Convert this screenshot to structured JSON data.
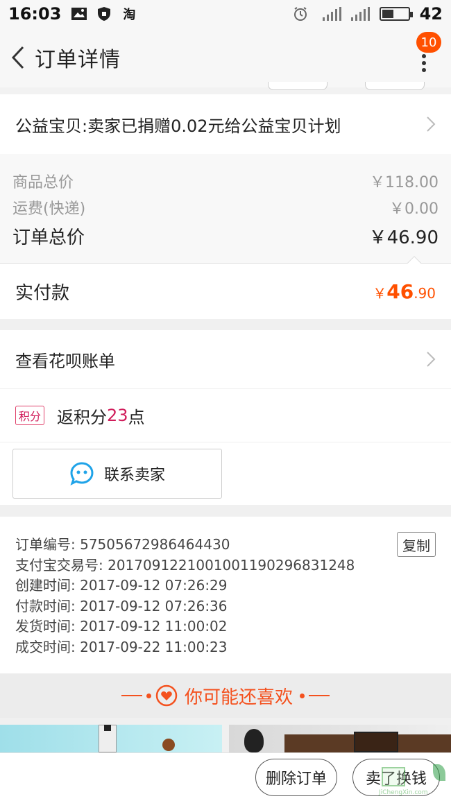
{
  "status_bar": {
    "time": "16:03",
    "taobao_glyph": "淘",
    "battery_level": "42",
    "icons": [
      "image-icon",
      "shield-icon",
      "taobao-icon",
      "alarm-icon",
      "signal-icon",
      "signal-icon",
      "battery-icon"
    ]
  },
  "header": {
    "title": "订单详情",
    "badge_count": "10"
  },
  "charity": {
    "text": "公益宝贝:卖家已捐赠0.02元给公益宝贝计划"
  },
  "prices": [
    {
      "label": "商品总价",
      "value": "￥118.00"
    },
    {
      "label": "运费(快递)",
      "value": "￥0.00"
    },
    {
      "label": "订单总价",
      "value": "￥46.90"
    }
  ],
  "paid": {
    "label": "实付款",
    "currency": "￥",
    "integer": "46",
    "decimal": ".90",
    "color": "#ff5000"
  },
  "huabei": {
    "label": "查看花呗账单"
  },
  "points": {
    "tag": "积分",
    "prefix": "返积分",
    "number": "23",
    "suffix": "点"
  },
  "contact": {
    "label": "联系卖家"
  },
  "order_info": {
    "copy_label": "复制",
    "lines": [
      "订单编号: 57505672986464430",
      "支付宝交易号: 2017091221001001190296831248",
      "创建时间: 2017-09-12 07:26:29",
      "付款时间: 2017-09-12 07:26:36",
      "发货时间: 2017-09-12 11:00:02",
      "成交时间: 2017-09-22 11:00:23"
    ]
  },
  "recommend": {
    "title": "你可能还喜欢"
  },
  "bottom_bar": {
    "delete_label": "删除订单",
    "sell_label": "卖了换钱"
  },
  "watermark": {
    "text": "JiChengXin.com"
  }
}
